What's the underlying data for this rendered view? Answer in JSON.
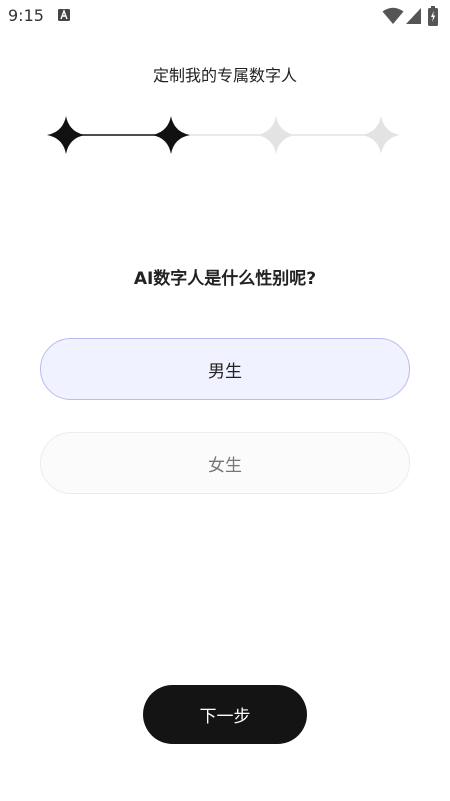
{
  "status_bar": {
    "time": "9:15",
    "notification_icon": "a-icon",
    "icons": [
      "wifi-icon",
      "signal-icon",
      "battery-icon"
    ]
  },
  "header": {
    "title": "定制我的专属数字人"
  },
  "progress": {
    "total_steps": 4,
    "completed_steps": 2,
    "active_color": "#111111",
    "inactive_color": "#e3e3e3"
  },
  "question": {
    "text": "AI数字人是什么性别呢?"
  },
  "options": [
    {
      "label": "男生",
      "selected": true
    },
    {
      "label": "女生",
      "selected": false
    }
  ],
  "footer": {
    "next_label": "下一步"
  },
  "colors": {
    "selected_bg": "#f1f2ff",
    "selected_border": "#b9bcef",
    "button_bg": "#141414"
  }
}
